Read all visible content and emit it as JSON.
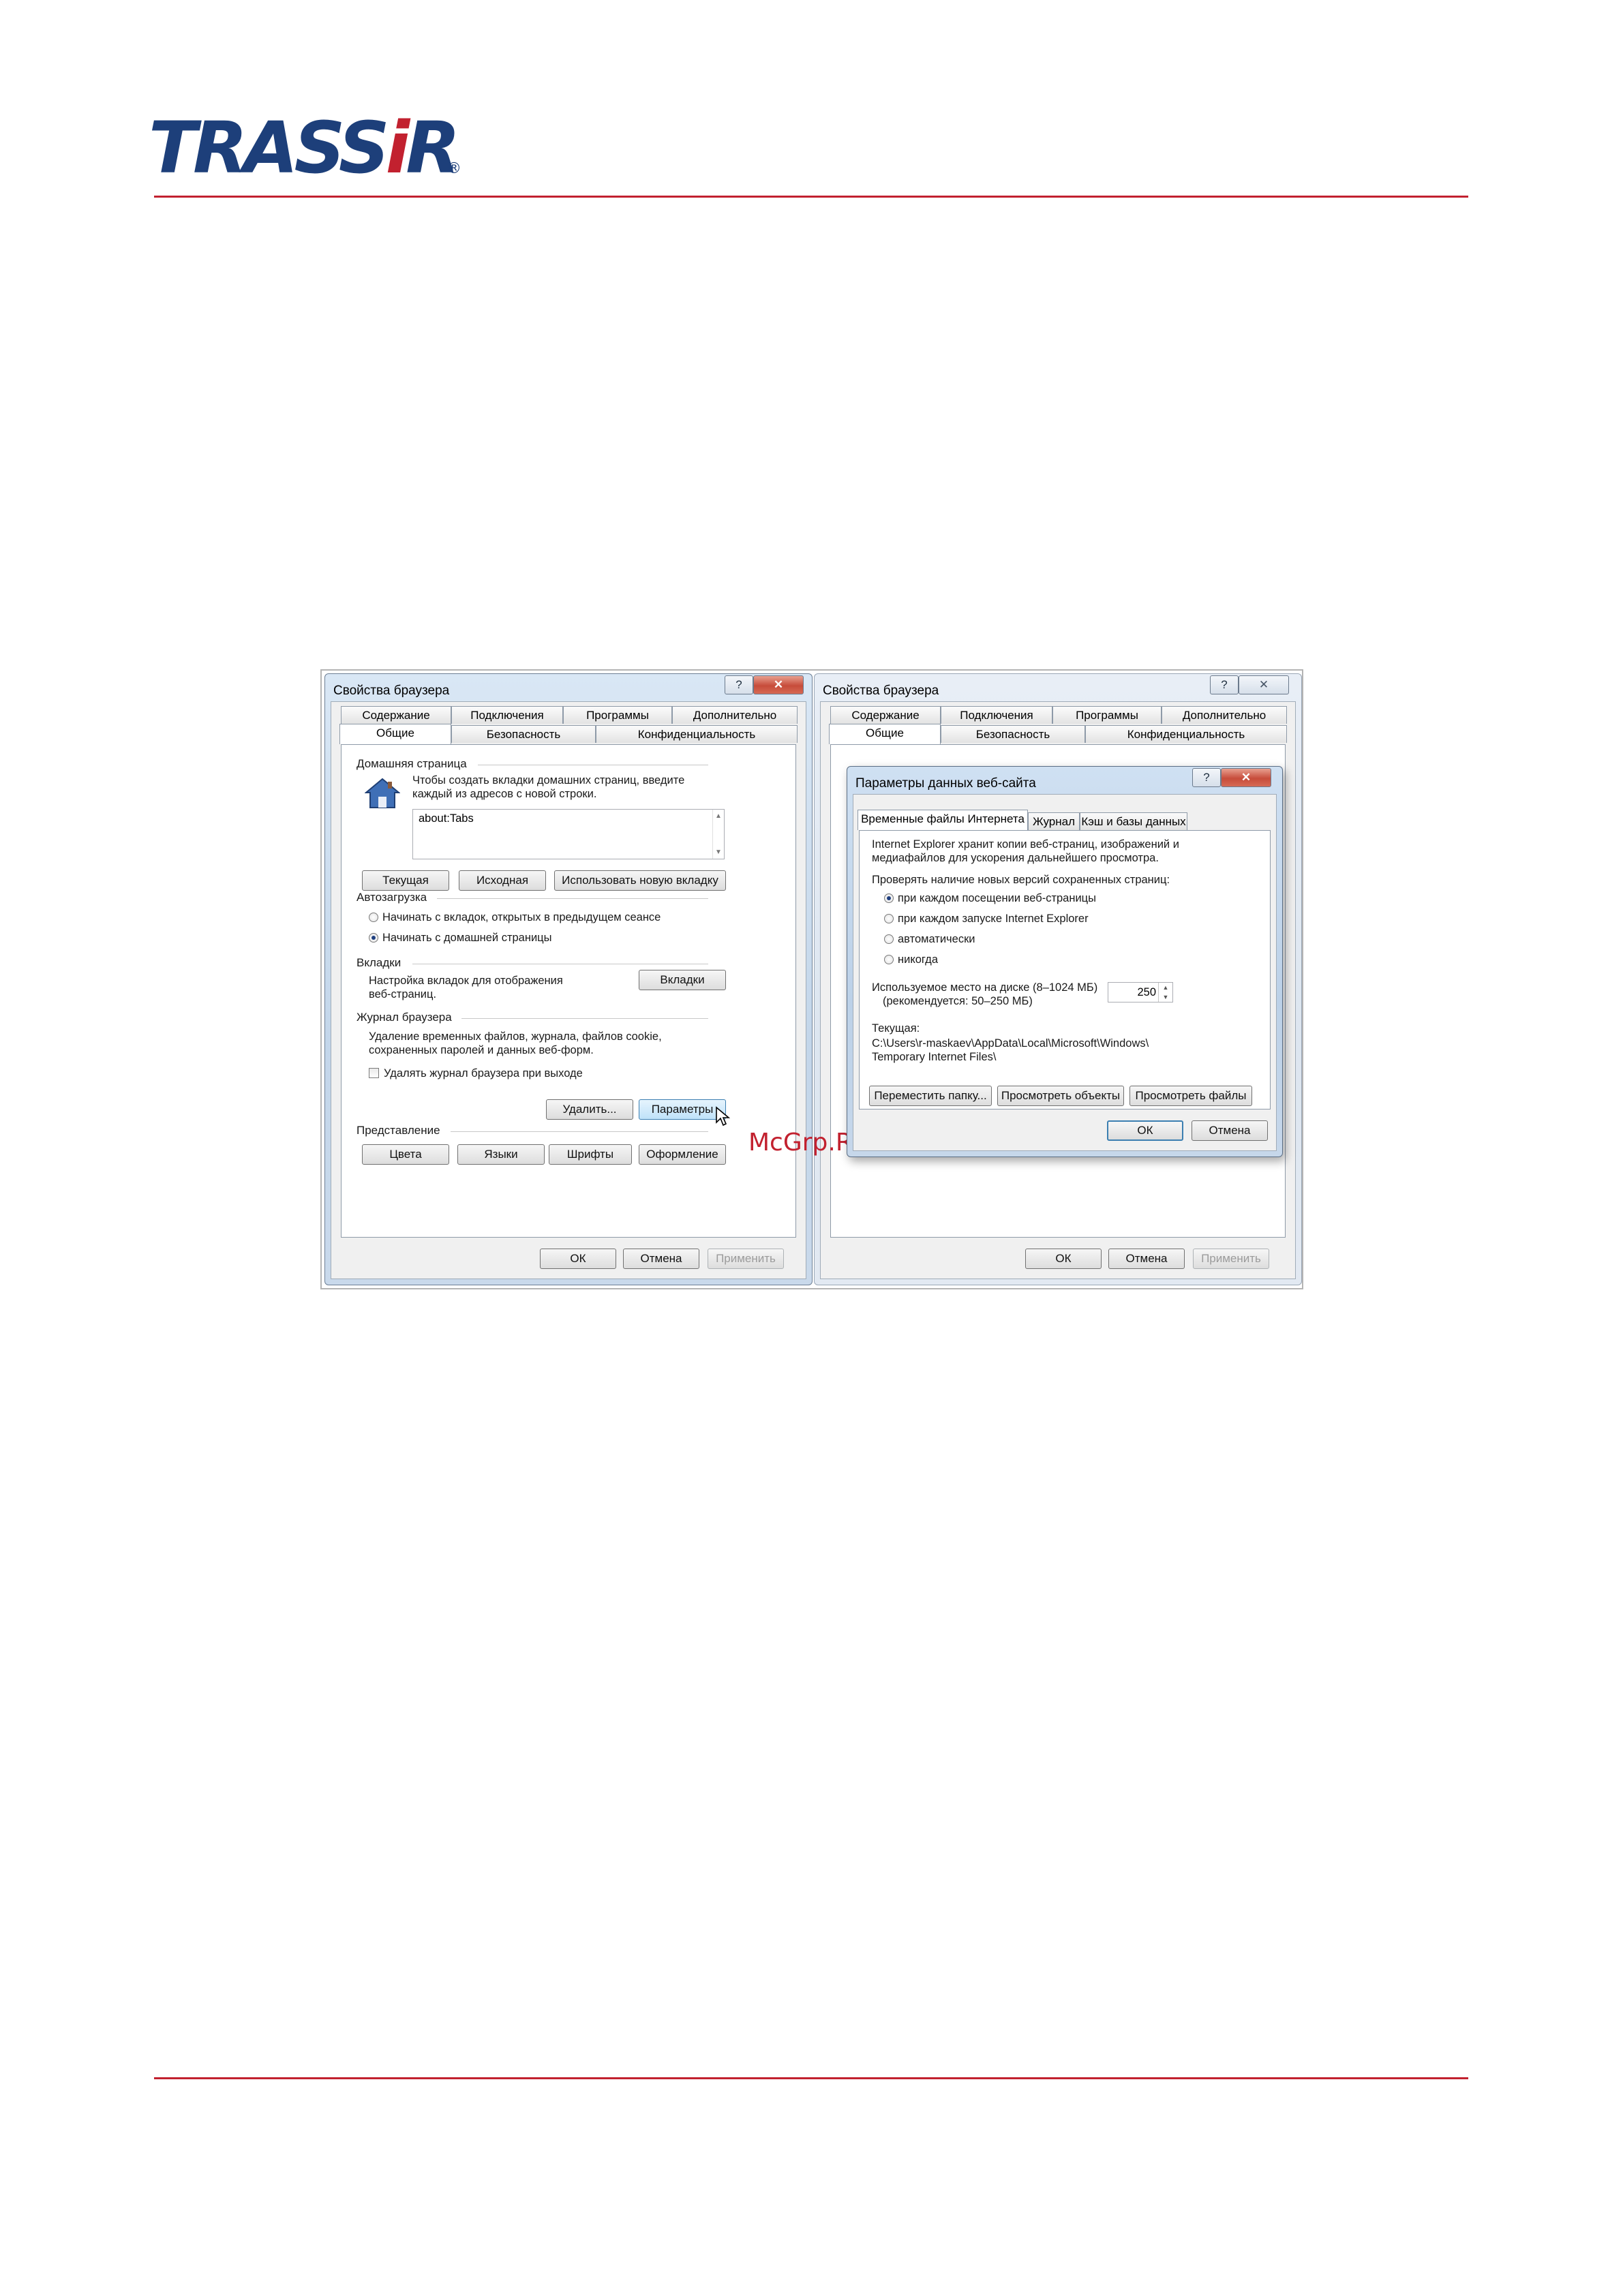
{
  "brand": {
    "logo_main": "TRASS",
    "logo_i": "i",
    "logo_r": "R",
    "logo_reg": "®"
  },
  "watermark": "McGrp.Ru",
  "left_window": {
    "title": "Свойства браузера",
    "help_btn": "?",
    "close_btn": "✕",
    "tabs_back": [
      "Содержание",
      "Подключения",
      "Программы",
      "Дополнительно"
    ],
    "tabs_front": [
      "Общие",
      "Безопасность",
      "Конфиденциальность"
    ],
    "home": {
      "group": "Домашняя страница",
      "text1": "Чтобы создать вкладки домашних страниц, введите",
      "text2": "каждый из адресов с новой строки.",
      "value": "about:Tabs",
      "btn_current": "Текущая",
      "btn_default": "Исходная",
      "btn_newtab": "Использовать новую вкладку"
    },
    "startup": {
      "group": "Автозагрузка",
      "opt1": "Начинать с вкладок, открытых в предыдущем сеансе",
      "opt2": "Начинать с домашней страницы"
    },
    "tabs_group": {
      "group": "Вкладки",
      "text1": "Настройка вкладок для отображения",
      "text2": "веб-страниц.",
      "btn": "Вкладки"
    },
    "history": {
      "group": "Журнал браузера",
      "text1": "Удаление временных файлов, журнала, файлов cookie,",
      "text2": "сохраненных паролей и данных веб-форм.",
      "check": "Удалять журнал браузера при выходе",
      "btn_delete": "Удалить...",
      "btn_params": "Параметры"
    },
    "appearance": {
      "group": "Представление",
      "btn_colors": "Цвета",
      "btn_langs": "Языки",
      "btn_fonts": "Шрифты",
      "btn_style": "Оформление"
    },
    "ok": "ОК",
    "cancel": "Отмена",
    "apply": "Применить"
  },
  "right_window": {
    "title": "Свойства браузера",
    "help_btn": "?",
    "close_btn": "✕",
    "tabs_back": [
      "Содержание",
      "Подключения",
      "Программы",
      "Дополнительно"
    ],
    "tabs_front": [
      "Общие",
      "Безопасность",
      "Конфиденциальность"
    ],
    "ok": "ОК",
    "cancel": "Отмена",
    "apply": "Применить"
  },
  "dialog": {
    "title": "Параметры данных веб-сайта",
    "help_btn": "?",
    "close_btn": "✕",
    "tabs": [
      "Временные файлы Интернета",
      "Журнал",
      "Кэш и базы данных"
    ],
    "intro1": "Internet Explorer хранит копии веб-страниц, изображений и",
    "intro2": "медиафайлов для ускорения дальнейшего просмотра.",
    "check_label": "Проверять наличие новых версий сохраненных страниц:",
    "opt1": "при каждом посещении веб-страницы",
    "opt2": "при каждом запуске Internet Explorer",
    "opt3": "автоматически",
    "opt4": "никогда",
    "disk1": "Используемое место на диске (8–1024 МБ)",
    "disk2": "(рекомендуется: 50–250 МБ)",
    "disk_value": "250",
    "current_label": "Текущая:",
    "path1": "C:\\Users\\r-maskaev\\AppData\\Local\\Microsoft\\Windows\\",
    "path2": "Temporary Internet Files\\",
    "btn_move": "Переместить папку...",
    "btn_objects": "Просмотреть объекты",
    "btn_files": "Просмотреть файлы",
    "ok": "ОК",
    "cancel": "Отмена"
  }
}
